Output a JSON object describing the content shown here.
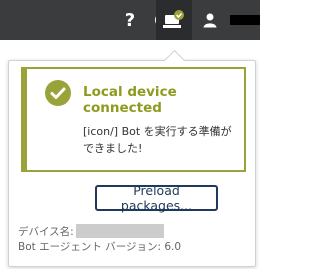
{
  "topbar": {
    "help_icon_glyph": "?",
    "icons": [
      "help-icon",
      "globe-icon",
      "device-connected-icon",
      "user-icon"
    ]
  },
  "status": {
    "title": "Local device connected",
    "message": "[icon/] Bot を実行する準備ができました!",
    "accent_color": "#9aa33a"
  },
  "actions": {
    "preload_label": "Preload packages..."
  },
  "info": {
    "device_name_label": "デバイス名:",
    "bot_version": "Bot エージェント バージョン: 6.0"
  }
}
